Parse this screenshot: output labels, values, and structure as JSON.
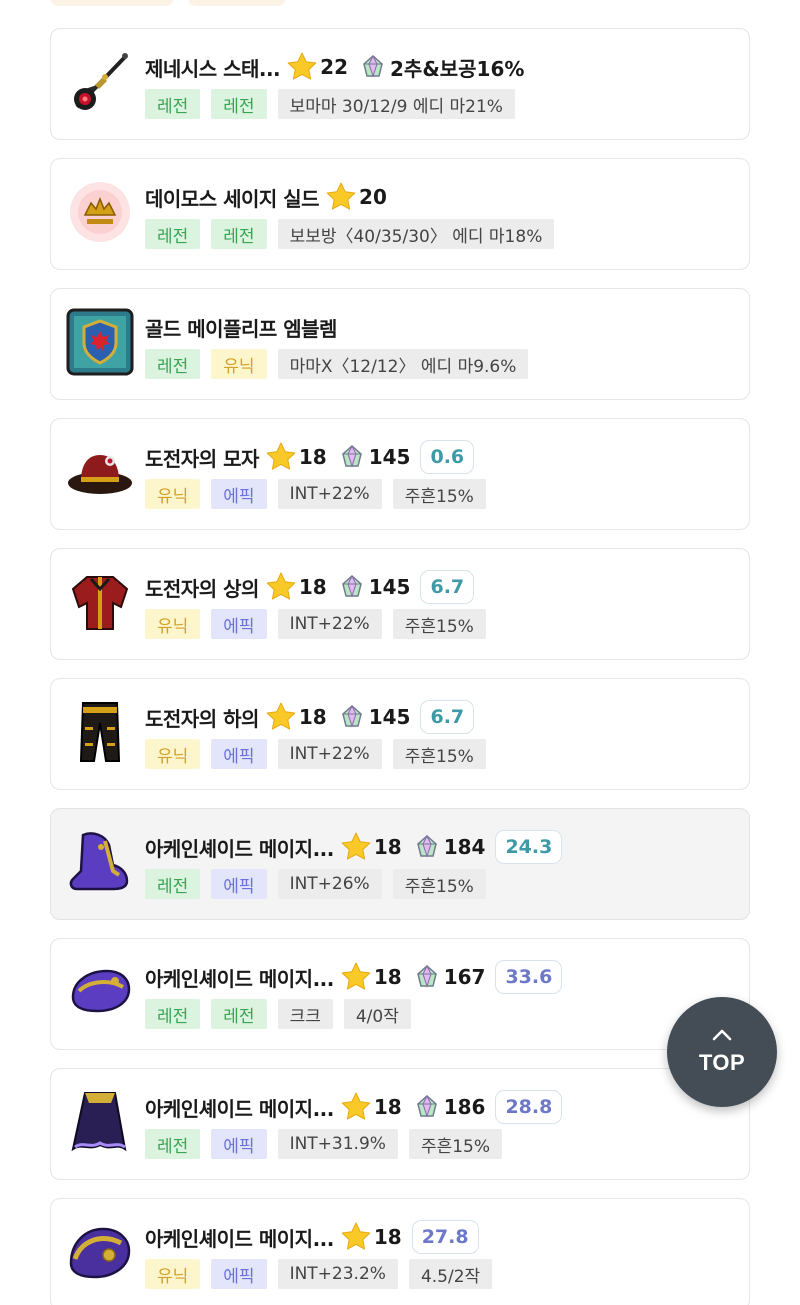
{
  "items": [
    {
      "name": "제네시스 스태...",
      "star": "22",
      "gem": "2추&보공16%",
      "score": "",
      "score_color": "",
      "icon": "genesis-staff-icon",
      "tags": [
        {
          "text": "레전",
          "kind": "legend"
        },
        {
          "text": "레전",
          "kind": "legend"
        },
        {
          "text": "보마마 30/12/9 에디 마21%",
          "kind": "opt"
        }
      ]
    },
    {
      "name": "데이모스 세이지 실드",
      "star": "20",
      "gem": "",
      "score": "",
      "score_color": "",
      "icon": "deimos-sage-shield-icon",
      "tags": [
        {
          "text": "레전",
          "kind": "legend"
        },
        {
          "text": "레전",
          "kind": "legend"
        },
        {
          "text": "보보방〈40/35/30〉 에디 마18%",
          "kind": "opt"
        }
      ]
    },
    {
      "name": "골드 메이플리프 엠블렘",
      "star": "",
      "gem": "",
      "score": "",
      "score_color": "",
      "icon": "gold-maple-leaf-emblem-icon",
      "tags": [
        {
          "text": "레전",
          "kind": "legend"
        },
        {
          "text": "유닉",
          "kind": "unique"
        },
        {
          "text": "마마X〈12/12〉 에디 마9.6%",
          "kind": "opt"
        }
      ]
    },
    {
      "name": "도전자의 모자",
      "star": "18",
      "gem": "145",
      "score": "0.6",
      "score_color": "teal",
      "icon": "challenger-hat-icon",
      "tags": [
        {
          "text": "유닉",
          "kind": "unique"
        },
        {
          "text": "에픽",
          "kind": "epic"
        },
        {
          "text": "INT+22%",
          "kind": "opt"
        },
        {
          "text": "주흔15%",
          "kind": "opt"
        }
      ]
    },
    {
      "name": "도전자의 상의",
      "star": "18",
      "gem": "145",
      "score": "6.7",
      "score_color": "teal",
      "icon": "challenger-top-icon",
      "tags": [
        {
          "text": "유닉",
          "kind": "unique"
        },
        {
          "text": "에픽",
          "kind": "epic"
        },
        {
          "text": "INT+22%",
          "kind": "opt"
        },
        {
          "text": "주흔15%",
          "kind": "opt"
        }
      ]
    },
    {
      "name": "도전자의 하의",
      "star": "18",
      "gem": "145",
      "score": "6.7",
      "score_color": "teal",
      "icon": "challenger-bottom-icon",
      "tags": [
        {
          "text": "유닉",
          "kind": "unique"
        },
        {
          "text": "에픽",
          "kind": "epic"
        },
        {
          "text": "INT+22%",
          "kind": "opt"
        },
        {
          "text": "주흔15%",
          "kind": "opt"
        }
      ]
    },
    {
      "name": "아케인셰이드 메이지...",
      "star": "18",
      "gem": "184",
      "score": "24.3",
      "score_color": "teal",
      "icon": "arcane-shoes-icon",
      "highlight": true,
      "tags": [
        {
          "text": "레전",
          "kind": "legend"
        },
        {
          "text": "에픽",
          "kind": "epic"
        },
        {
          "text": "INT+26%",
          "kind": "opt"
        },
        {
          "text": "주흔15%",
          "kind": "opt"
        }
      ]
    },
    {
      "name": "아케인셰이드 메이지...",
      "star": "18",
      "gem": "167",
      "score": "33.6",
      "score_color": "purple",
      "icon": "arcane-gloves-icon",
      "tags": [
        {
          "text": "레전",
          "kind": "legend"
        },
        {
          "text": "레전",
          "kind": "legend"
        },
        {
          "text": "크크",
          "kind": "opt"
        },
        {
          "text": "4/0작",
          "kind": "opt"
        }
      ]
    },
    {
      "name": "아케인셰이드 메이지...",
      "star": "18",
      "gem": "186",
      "score": "28.8",
      "score_color": "purple",
      "icon": "arcane-cape-icon",
      "tags": [
        {
          "text": "레전",
          "kind": "legend"
        },
        {
          "text": "에픽",
          "kind": "epic"
        },
        {
          "text": "INT+31.9%",
          "kind": "opt"
        },
        {
          "text": "주흔15%",
          "kind": "opt"
        }
      ]
    },
    {
      "name": "아케인셰이드 메이지...",
      "star": "18",
      "gem": "",
      "score": "27.8",
      "score_color": "purple",
      "icon": "arcane-shoulder-icon",
      "tags": [
        {
          "text": "유닉",
          "kind": "unique"
        },
        {
          "text": "에픽",
          "kind": "epic"
        },
        {
          "text": "INT+23.2%",
          "kind": "opt"
        },
        {
          "text": "4.5/2작",
          "kind": "opt"
        }
      ]
    }
  ],
  "top_button": {
    "label": "TOP",
    "icon": "chevron-up-icon"
  },
  "colors": {
    "legend": "#3aa354",
    "unique": "#d1a12a",
    "epic": "#6a72d8",
    "score_teal": "#3f9aa8",
    "score_purple": "#6d78c9",
    "top_button_bg": "#444c55"
  }
}
